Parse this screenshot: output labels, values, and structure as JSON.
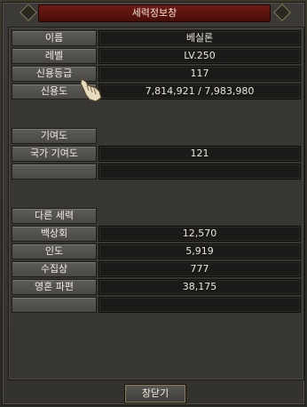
{
  "window": {
    "title": "세력정보창"
  },
  "sections": {
    "info": [
      {
        "label": "이름",
        "value": "베실론"
      },
      {
        "label": "레벨",
        "value": "LV.250"
      },
      {
        "label": "신용등급",
        "value": "117"
      },
      {
        "label": "신용도",
        "value": "7,814,921 / 7,983,980"
      }
    ],
    "contribution": [
      {
        "label": "기여도",
        "value": ""
      },
      {
        "label": "국가 기여도",
        "value": "121"
      },
      {
        "label": "",
        "value": ""
      }
    ],
    "other": [
      {
        "label": "다른 세력",
        "value": ""
      },
      {
        "label": "백상회",
        "value": "12,570"
      },
      {
        "label": "인도",
        "value": "5,919"
      },
      {
        "label": "수집상",
        "value": "777"
      },
      {
        "label": "영혼 파편",
        "value": "38,175"
      },
      {
        "label": "",
        "value": ""
      }
    ]
  },
  "footer": {
    "close_label": "창닫기"
  },
  "icons": {
    "cursor": "pointer-hand-icon"
  }
}
